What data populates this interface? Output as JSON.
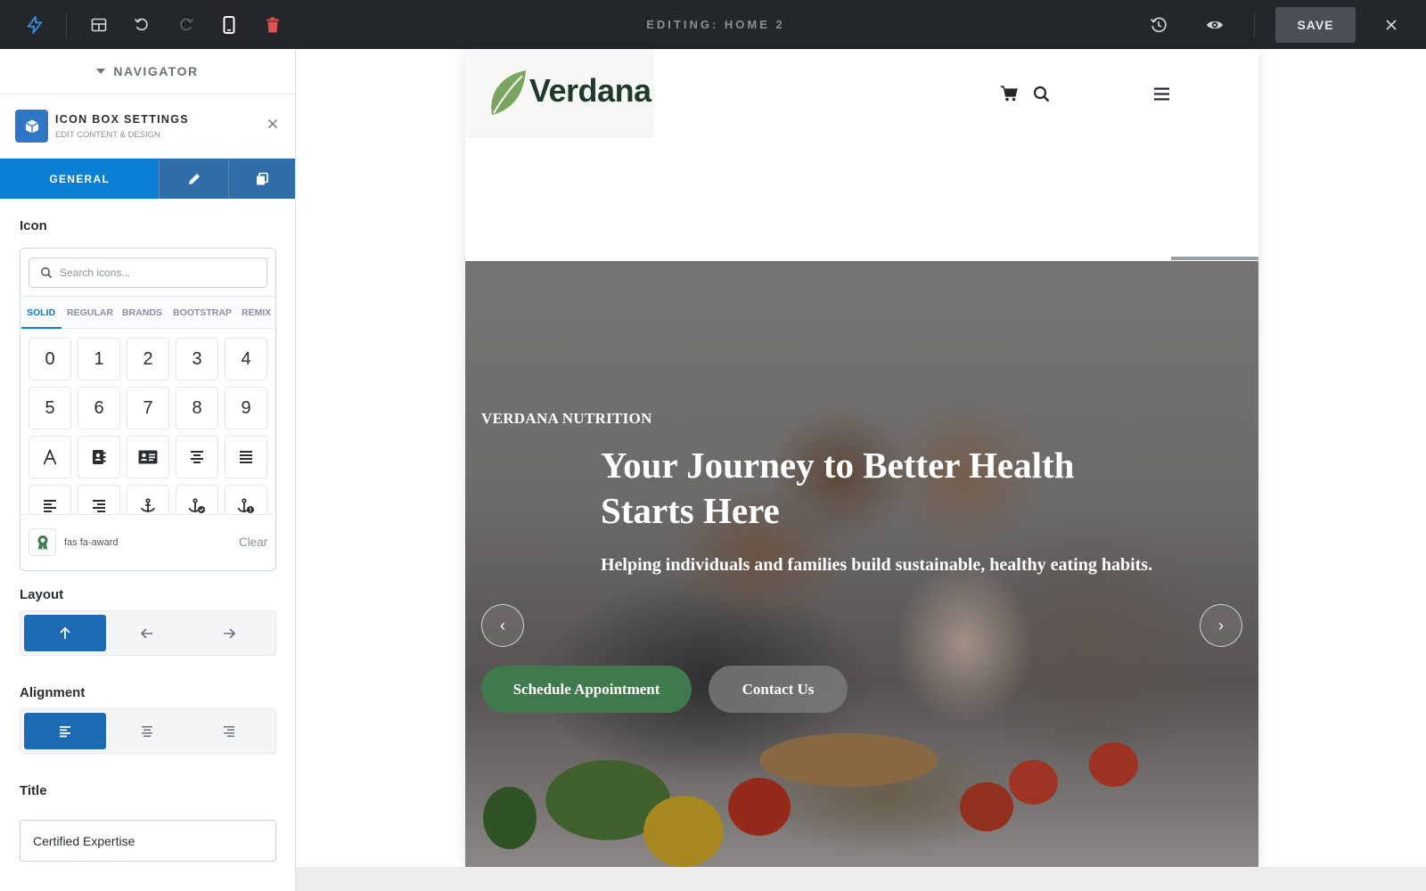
{
  "topbar": {
    "title": "EDITING: HOME 2",
    "save_label": "SAVE",
    "icons": [
      "bolt-icon",
      "layout-icon",
      "undo-icon",
      "redo-icon",
      "mobile-icon",
      "trash-icon",
      "history-icon",
      "preview-icon",
      "close-icon"
    ],
    "accent": "#2f8fe0",
    "danger": "#e05252"
  },
  "sidebar": {
    "navigator_label": "NAVIGATOR",
    "settings_title": "ICON BOX SETTINGS",
    "settings_subtitle": "EDIT CONTENT & DESIGN",
    "tabs": {
      "general": "GENERAL"
    },
    "icon_section": {
      "label": "Icon",
      "search_placeholder": "Search icons...",
      "libraries": [
        "SOLID",
        "REGULAR",
        "BRANDS",
        "BOOTSTRAP",
        "REMIX"
      ],
      "active_library": "SOLID",
      "grid": [
        "0",
        "1",
        "2",
        "3",
        "4",
        "5",
        "6",
        "7",
        "8",
        "9"
      ],
      "current_icon": "fas fa-award",
      "clear_label": "Clear"
    },
    "layout_label": "Layout",
    "layout_active": "top",
    "alignment_label": "Alignment",
    "alignment_active": "left",
    "title_label": "Title",
    "title_value": "Certified Expertise",
    "accent": "#0a7fd4"
  },
  "site": {
    "logo_text": "Verdana",
    "header_icons": [
      "cart-icon",
      "search-icon",
      "menu-icon"
    ],
    "hero": {
      "kicker": "VERDANA NUTRITION",
      "title": "Your Journey to Better Health Starts Here",
      "subtitle": "Helping individuals and families build sustainable, healthy eating habits.",
      "prev": "‹",
      "next": "›",
      "cta_primary": "Schedule Appointment",
      "cta_secondary": "Contact Us",
      "primary_color": "#3f7a4d"
    }
  }
}
